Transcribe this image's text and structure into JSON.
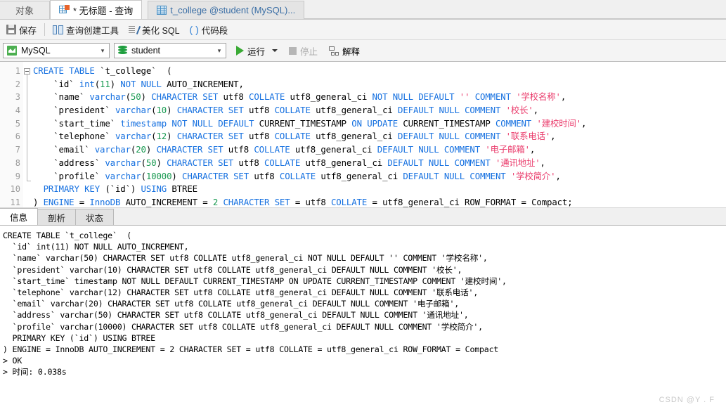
{
  "window": {
    "tabs": [
      {
        "label": "对象",
        "icon": "none",
        "active": false
      },
      {
        "label": "* 无标题 - 查询",
        "icon": "query-icon",
        "active": true
      },
      {
        "label": "t_college @student (MySQL)...",
        "icon": "grid-icon",
        "active": false
      }
    ]
  },
  "toolbar": {
    "save_label": "保存",
    "query_builder_label": "查询创建工具",
    "beautify_label": "美化 SQL",
    "snippet_label": "代码段",
    "snippet_glyph": "( )",
    "connection_value": "MySQL",
    "database_value": "student",
    "run_label": "运行",
    "stop_label": "停止",
    "explain_label": "解释"
  },
  "editor": {
    "line_numbers": [
      "1",
      "2",
      "3",
      "4",
      "5",
      "6",
      "7",
      "8",
      "9",
      "10",
      "11"
    ],
    "lines": [
      [
        {
          "t": "CREATE",
          "c": "kw"
        },
        {
          "t": " ",
          "c": "pl"
        },
        {
          "t": "TABLE",
          "c": "kw"
        },
        {
          "t": " `t_college`  (",
          "c": "id"
        }
      ],
      [
        {
          "t": "    `id` ",
          "c": "id"
        },
        {
          "t": "int",
          "c": "kw"
        },
        {
          "t": "(",
          "c": "pl"
        },
        {
          "t": "11",
          "c": "num"
        },
        {
          "t": ") ",
          "c": "pl"
        },
        {
          "t": "NOT",
          "c": "kw"
        },
        {
          "t": " ",
          "c": "pl"
        },
        {
          "t": "NULL",
          "c": "kw"
        },
        {
          "t": " AUTO_INCREMENT,",
          "c": "id"
        }
      ],
      [
        {
          "t": "    `name` ",
          "c": "id"
        },
        {
          "t": "varchar",
          "c": "kw"
        },
        {
          "t": "(",
          "c": "pl"
        },
        {
          "t": "50",
          "c": "num"
        },
        {
          "t": ") ",
          "c": "pl"
        },
        {
          "t": "CHARACTER SET",
          "c": "kw"
        },
        {
          "t": " utf8 ",
          "c": "id"
        },
        {
          "t": "COLLATE",
          "c": "kw"
        },
        {
          "t": " utf8_general_ci ",
          "c": "id"
        },
        {
          "t": "NOT",
          "c": "kw"
        },
        {
          "t": " ",
          "c": "pl"
        },
        {
          "t": "NULL",
          "c": "kw"
        },
        {
          "t": " ",
          "c": "pl"
        },
        {
          "t": "DEFAULT",
          "c": "kw"
        },
        {
          "t": " ",
          "c": "pl"
        },
        {
          "t": "''",
          "c": "str"
        },
        {
          "t": " ",
          "c": "pl"
        },
        {
          "t": "COMMENT",
          "c": "kw"
        },
        {
          "t": " ",
          "c": "pl"
        },
        {
          "t": "'学校名称'",
          "c": "str"
        },
        {
          "t": ",",
          "c": "id"
        }
      ],
      [
        {
          "t": "    `president` ",
          "c": "id"
        },
        {
          "t": "varchar",
          "c": "kw"
        },
        {
          "t": "(",
          "c": "pl"
        },
        {
          "t": "10",
          "c": "num"
        },
        {
          "t": ") ",
          "c": "pl"
        },
        {
          "t": "CHARACTER SET",
          "c": "kw"
        },
        {
          "t": " utf8 ",
          "c": "id"
        },
        {
          "t": "COLLATE",
          "c": "kw"
        },
        {
          "t": " utf8_general_ci ",
          "c": "id"
        },
        {
          "t": "DEFAULT",
          "c": "kw"
        },
        {
          "t": " ",
          "c": "pl"
        },
        {
          "t": "NULL",
          "c": "kw"
        },
        {
          "t": " ",
          "c": "pl"
        },
        {
          "t": "COMMENT",
          "c": "kw"
        },
        {
          "t": " ",
          "c": "pl"
        },
        {
          "t": "'校长'",
          "c": "str"
        },
        {
          "t": ",",
          "c": "id"
        }
      ],
      [
        {
          "t": "    `start_time` ",
          "c": "id"
        },
        {
          "t": "timestamp",
          "c": "kw"
        },
        {
          "t": " ",
          "c": "pl"
        },
        {
          "t": "NOT",
          "c": "kw"
        },
        {
          "t": " ",
          "c": "pl"
        },
        {
          "t": "NULL",
          "c": "kw"
        },
        {
          "t": " ",
          "c": "pl"
        },
        {
          "t": "DEFAULT",
          "c": "kw"
        },
        {
          "t": " CURRENT_TIMESTAMP ",
          "c": "id"
        },
        {
          "t": "ON UPDATE",
          "c": "kw"
        },
        {
          "t": " CURRENT_TIMESTAMP ",
          "c": "id"
        },
        {
          "t": "COMMENT",
          "c": "kw"
        },
        {
          "t": " ",
          "c": "pl"
        },
        {
          "t": "'建校时间'",
          "c": "str"
        },
        {
          "t": ",",
          "c": "id"
        }
      ],
      [
        {
          "t": "    `telephone` ",
          "c": "id"
        },
        {
          "t": "varchar",
          "c": "kw"
        },
        {
          "t": "(",
          "c": "pl"
        },
        {
          "t": "12",
          "c": "num"
        },
        {
          "t": ") ",
          "c": "pl"
        },
        {
          "t": "CHARACTER SET",
          "c": "kw"
        },
        {
          "t": " utf8 ",
          "c": "id"
        },
        {
          "t": "COLLATE",
          "c": "kw"
        },
        {
          "t": " utf8_general_ci ",
          "c": "id"
        },
        {
          "t": "DEFAULT",
          "c": "kw"
        },
        {
          "t": " ",
          "c": "pl"
        },
        {
          "t": "NULL",
          "c": "kw"
        },
        {
          "t": " ",
          "c": "pl"
        },
        {
          "t": "COMMENT",
          "c": "kw"
        },
        {
          "t": " ",
          "c": "pl"
        },
        {
          "t": "'联系电话'",
          "c": "str"
        },
        {
          "t": ",",
          "c": "id"
        }
      ],
      [
        {
          "t": "    `email` ",
          "c": "id"
        },
        {
          "t": "varchar",
          "c": "kw"
        },
        {
          "t": "(",
          "c": "pl"
        },
        {
          "t": "20",
          "c": "num"
        },
        {
          "t": ") ",
          "c": "pl"
        },
        {
          "t": "CHARACTER SET",
          "c": "kw"
        },
        {
          "t": " utf8 ",
          "c": "id"
        },
        {
          "t": "COLLATE",
          "c": "kw"
        },
        {
          "t": " utf8_general_ci ",
          "c": "id"
        },
        {
          "t": "DEFAULT",
          "c": "kw"
        },
        {
          "t": " ",
          "c": "pl"
        },
        {
          "t": "NULL",
          "c": "kw"
        },
        {
          "t": " ",
          "c": "pl"
        },
        {
          "t": "COMMENT",
          "c": "kw"
        },
        {
          "t": " ",
          "c": "pl"
        },
        {
          "t": "'电子邮箱'",
          "c": "str"
        },
        {
          "t": ",",
          "c": "id"
        }
      ],
      [
        {
          "t": "    `address` ",
          "c": "id"
        },
        {
          "t": "varchar",
          "c": "kw"
        },
        {
          "t": "(",
          "c": "pl"
        },
        {
          "t": "50",
          "c": "num"
        },
        {
          "t": ") ",
          "c": "pl"
        },
        {
          "t": "CHARACTER SET",
          "c": "kw"
        },
        {
          "t": " utf8 ",
          "c": "id"
        },
        {
          "t": "COLLATE",
          "c": "kw"
        },
        {
          "t": " utf8_general_ci ",
          "c": "id"
        },
        {
          "t": "DEFAULT",
          "c": "kw"
        },
        {
          "t": " ",
          "c": "pl"
        },
        {
          "t": "NULL",
          "c": "kw"
        },
        {
          "t": " ",
          "c": "pl"
        },
        {
          "t": "COMMENT",
          "c": "kw"
        },
        {
          "t": " ",
          "c": "pl"
        },
        {
          "t": "'通讯地址'",
          "c": "str"
        },
        {
          "t": ",",
          "c": "id"
        }
      ],
      [
        {
          "t": "    `profile` ",
          "c": "id"
        },
        {
          "t": "varchar",
          "c": "kw"
        },
        {
          "t": "(",
          "c": "pl"
        },
        {
          "t": "10000",
          "c": "num"
        },
        {
          "t": ") ",
          "c": "pl"
        },
        {
          "t": "CHARACTER SET",
          "c": "kw"
        },
        {
          "t": " utf8 ",
          "c": "id"
        },
        {
          "t": "COLLATE",
          "c": "kw"
        },
        {
          "t": " utf8_general_ci ",
          "c": "id"
        },
        {
          "t": "DEFAULT",
          "c": "kw"
        },
        {
          "t": " ",
          "c": "pl"
        },
        {
          "t": "NULL",
          "c": "kw"
        },
        {
          "t": " ",
          "c": "pl"
        },
        {
          "t": "COMMENT",
          "c": "kw"
        },
        {
          "t": " ",
          "c": "pl"
        },
        {
          "t": "'学校简介'",
          "c": "str"
        },
        {
          "t": ",",
          "c": "id"
        }
      ],
      [
        {
          "t": "  ",
          "c": "pl"
        },
        {
          "t": "PRIMARY KEY",
          "c": "kw"
        },
        {
          "t": " (`id`) ",
          "c": "id"
        },
        {
          "t": "USING",
          "c": "kw"
        },
        {
          "t": " BTREE",
          "c": "id"
        }
      ],
      [
        {
          "t": ") ",
          "c": "id"
        },
        {
          "t": "ENGINE",
          "c": "kw"
        },
        {
          "t": " = ",
          "c": "id"
        },
        {
          "t": "InnoDB",
          "c": "kw"
        },
        {
          "t": " AUTO_INCREMENT = ",
          "c": "id"
        },
        {
          "t": "2",
          "c": "num"
        },
        {
          "t": " ",
          "c": "pl"
        },
        {
          "t": "CHARACTER SET",
          "c": "kw"
        },
        {
          "t": " = utf8 ",
          "c": "id"
        },
        {
          "t": "COLLATE",
          "c": "kw"
        },
        {
          "t": " = utf8_general_ci ROW_FORMAT = Compact;",
          "c": "id"
        }
      ]
    ]
  },
  "results": {
    "tabs": [
      {
        "label": "信息",
        "active": true
      },
      {
        "label": "剖析",
        "active": false
      },
      {
        "label": "状态",
        "active": false
      }
    ],
    "output_text": "CREATE TABLE `t_college`  (\n  `id` int(11) NOT NULL AUTO_INCREMENT,\n  `name` varchar(50) CHARACTER SET utf8 COLLATE utf8_general_ci NOT NULL DEFAULT '' COMMENT '学校名称',\n  `president` varchar(10) CHARACTER SET utf8 COLLATE utf8_general_ci DEFAULT NULL COMMENT '校长',\n  `start_time` timestamp NOT NULL DEFAULT CURRENT_TIMESTAMP ON UPDATE CURRENT_TIMESTAMP COMMENT '建校时间',\n  `telephone` varchar(12) CHARACTER SET utf8 COLLATE utf8_general_ci DEFAULT NULL COMMENT '联系电话',\n  `email` varchar(20) CHARACTER SET utf8 COLLATE utf8_general_ci DEFAULT NULL COMMENT '电子邮箱',\n  `address` varchar(50) CHARACTER SET utf8 COLLATE utf8_general_ci DEFAULT NULL COMMENT '通讯地址',\n  `profile` varchar(10000) CHARACTER SET utf8 COLLATE utf8_general_ci DEFAULT NULL COMMENT '学校简介',\n  PRIMARY KEY (`id`) USING BTREE\n) ENGINE = InnoDB AUTO_INCREMENT = 2 CHARACTER SET = utf8 COLLATE = utf8_general_ci ROW_FORMAT = Compact\n> OK\n> 时间: 0.038s"
  },
  "watermark": "CSDN @Y . F",
  "colors": {
    "keyword": "#1570e0",
    "number": "#1a9a52",
    "string": "#ea3b6b",
    "run_green": "#3aaa35"
  }
}
